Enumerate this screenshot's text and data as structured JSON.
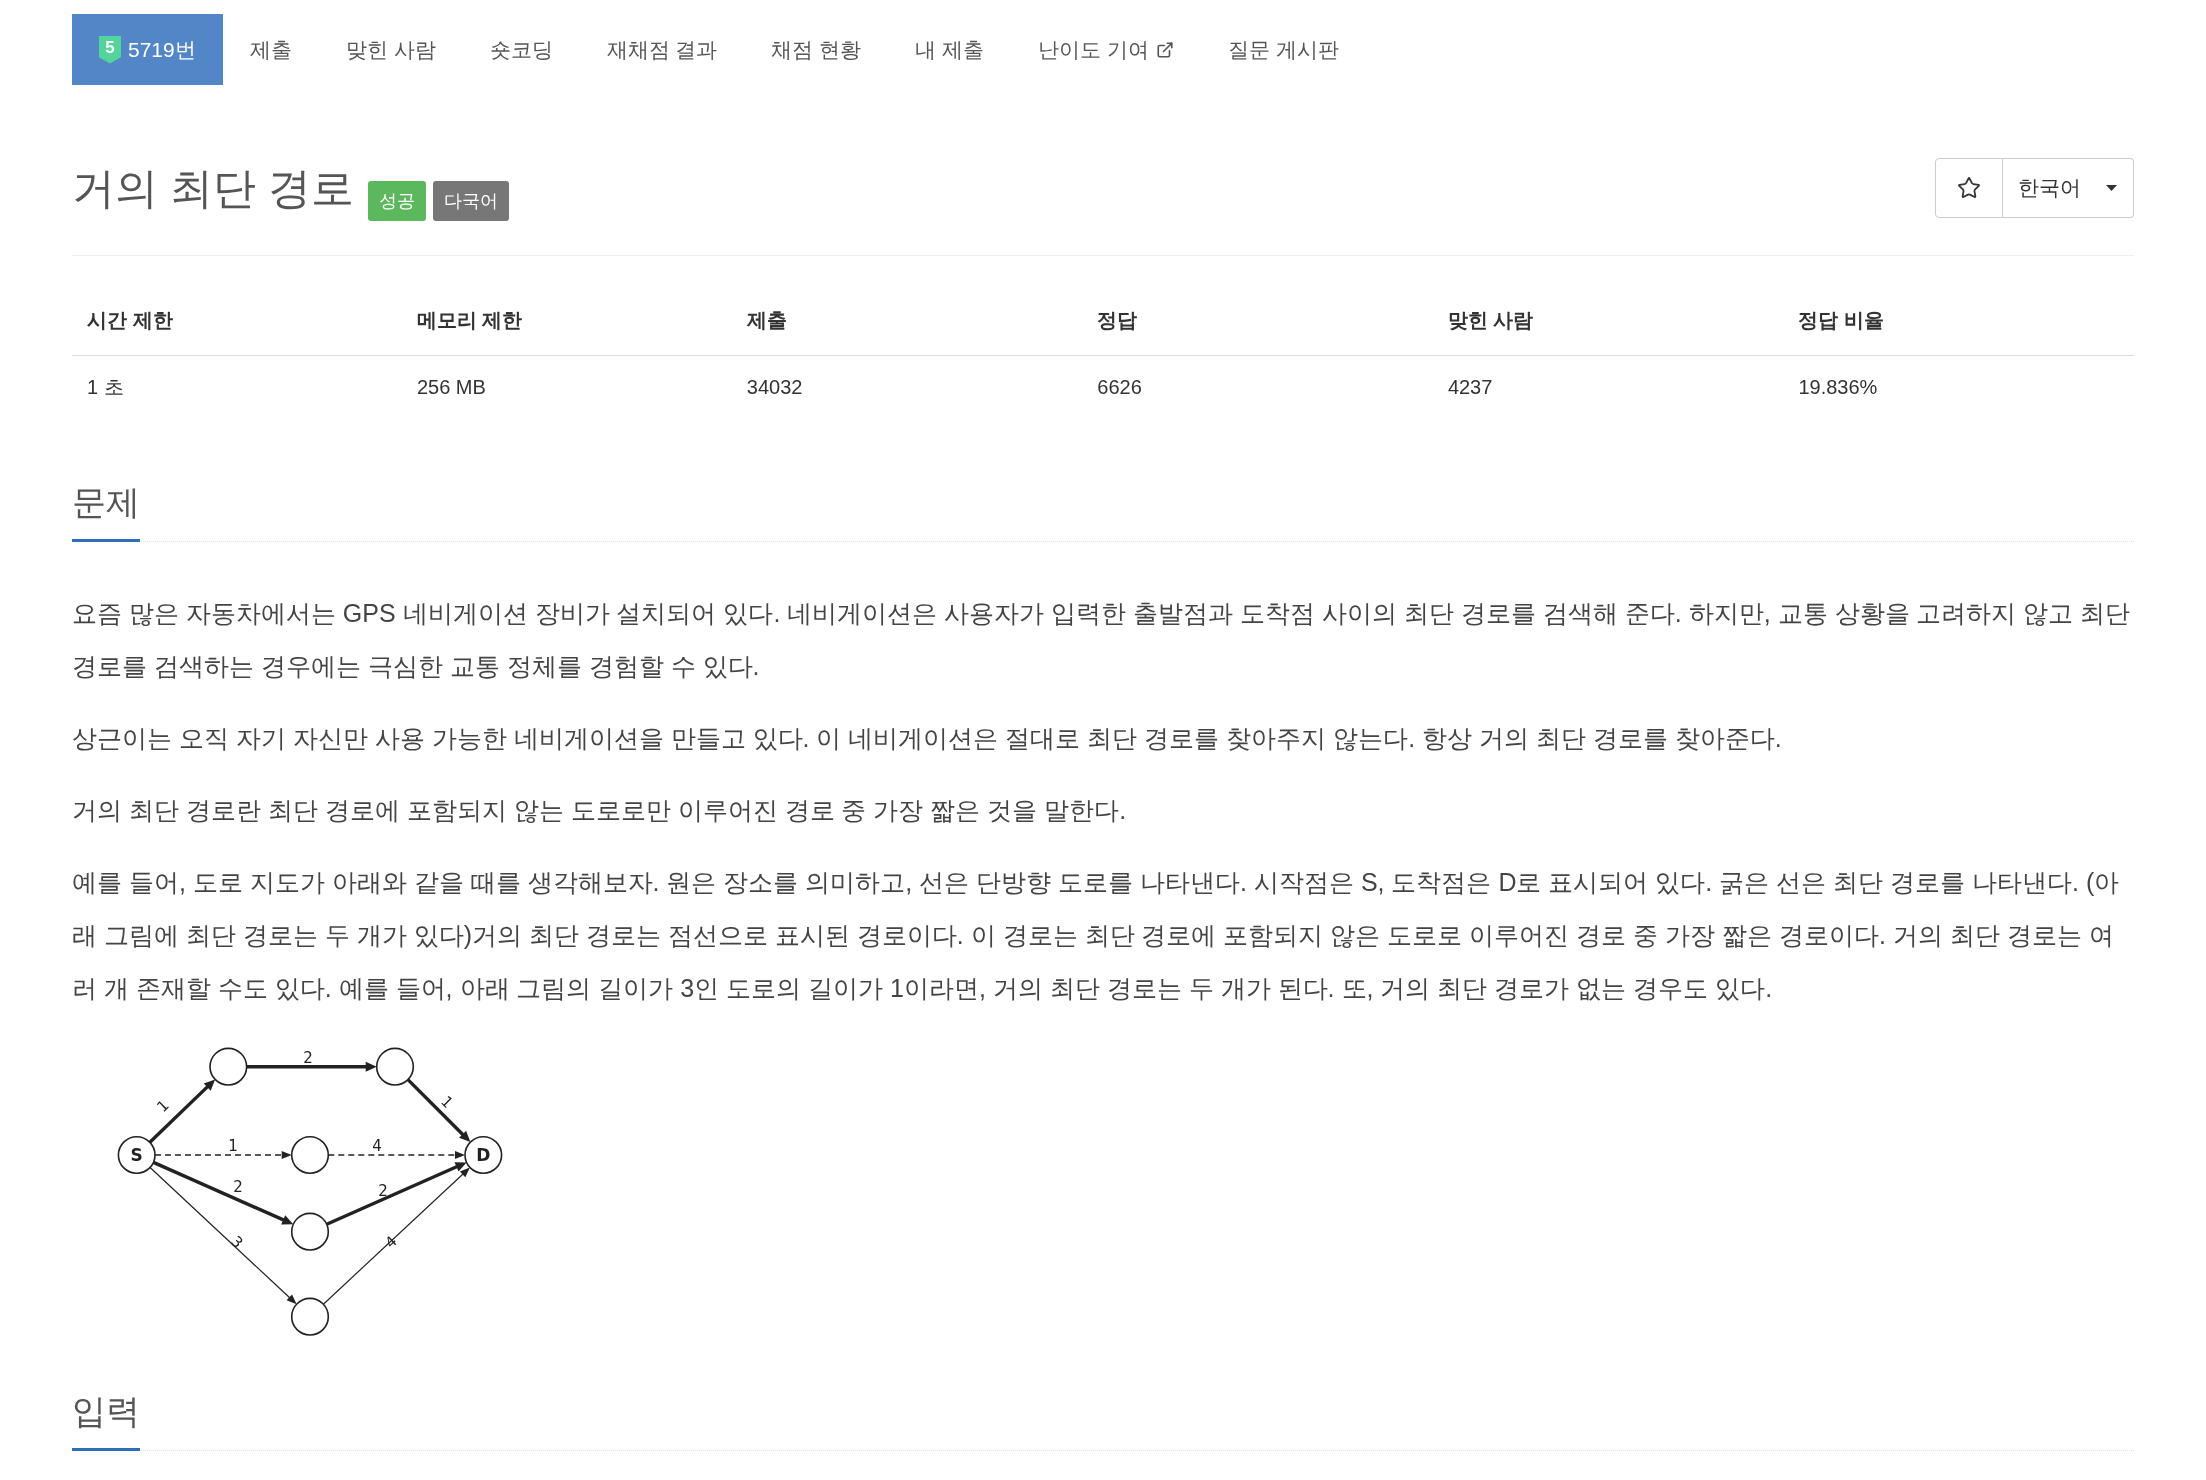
{
  "nav": {
    "tabs": [
      {
        "label": "5719번",
        "selected": true,
        "external": false,
        "tier": "5"
      },
      {
        "label": "제출",
        "selected": false,
        "external": false
      },
      {
        "label": "맞힌 사람",
        "selected": false,
        "external": false
      },
      {
        "label": "숏코딩",
        "selected": false,
        "external": false
      },
      {
        "label": "재채점 결과",
        "selected": false,
        "external": false
      },
      {
        "label": "채점 현황",
        "selected": false,
        "external": false
      },
      {
        "label": "내 제출",
        "selected": false,
        "external": false
      },
      {
        "label": "난이도 기여",
        "selected": false,
        "external": true
      },
      {
        "label": "질문 게시판",
        "selected": false,
        "external": false
      }
    ]
  },
  "problem": {
    "title": "거의 최단 경로",
    "labels": [
      {
        "label": "성공",
        "kind": "success"
      },
      {
        "label": "다국어",
        "kind": "language"
      }
    ],
    "starred": false,
    "language": "한국어"
  },
  "limits_table": {
    "columns": [
      "시간 제한",
      "메모리 제한",
      "제출",
      "정답",
      "맞힌 사람",
      "정답 비율"
    ],
    "rows": [
      [
        "1 초",
        "256 MB",
        "34032",
        "6626",
        "4237",
        "19.836%"
      ]
    ]
  },
  "sections": [
    {
      "heading": "문제",
      "paragraphs": [
        "요즘 많은 자동차에서는 GPS 네비게이션 장비가 설치되어 있다. 네비게이션은 사용자가 입력한 출발점과 도착점 사이의 최단 경로를 검색해 준다. 하지만, 교통 상황을 고려하지 않고 최단 경로를 검색하는 경우에는 극심한 교통 정체를 경험할 수 있다.",
        "상근이는 오직 자기 자신만 사용 가능한 네비게이션을 만들고 있다. 이 네비게이션은 절대로 최단 경로를 찾아주지 않는다. 항상 거의 최단 경로를 찾아준다.",
        "거의 최단 경로란 최단 경로에 포함되지 않는 도로로만 이루어진 경로 중 가장 짧은 것을 말한다.",
        "예를 들어, 도로 지도가 아래와 같을 때를 생각해보자. 원은 장소를 의미하고, 선은 단방향 도로를 나타낸다. 시작점은 S, 도착점은 D로 표시되어 있다. 굵은 선은 최단 경로를 나타낸다. (아래 그림에 최단 경로는 두 개가 있다)거의 최단 경로는 점선으로 표시된 경로이다. 이 경로는 최단 경로에 포함되지 않은 도로로 이루어진 경로 중 가장 짧은 경로이다. 거의 최단 경로는 여러 개 존재할 수도 있다. 예를 들어, 아래 그림의 길이가 3인 도로의 길이가 1이라면, 거의 최단 경로는 두 개가 된다. 또, 거의 최단 경로가 없는 경우도 있다."
      ],
      "figure": {
        "nodes": [
          {
            "kind": "terminal",
            "label": "S"
          },
          {
            "kind": "junction"
          },
          {
            "kind": "junction"
          },
          {
            "kind": "junction"
          },
          {
            "kind": "junction"
          },
          {
            "kind": "junction"
          },
          {
            "kind": "terminal",
            "label": "D"
          }
        ],
        "edges": [
          {
            "weight": "1",
            "kind": "bold"
          },
          {
            "weight": "2",
            "kind": "bold"
          },
          {
            "weight": "1",
            "kind": "bold"
          },
          {
            "weight": "1",
            "kind": "dashed"
          },
          {
            "weight": "4",
            "kind": "dashed"
          },
          {
            "weight": "2",
            "kind": "bold"
          },
          {
            "weight": "2",
            "kind": "bold"
          },
          {
            "weight": "3",
            "kind": "thin"
          },
          {
            "weight": "4",
            "kind": "thin"
          }
        ]
      }
    },
    {
      "heading": "입력"
    }
  ]
}
